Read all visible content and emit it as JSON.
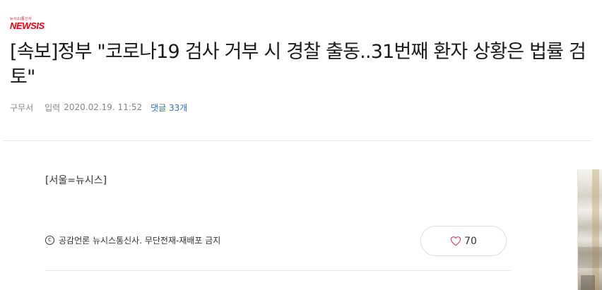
{
  "logo": {
    "tagline": "뉴시스|통신사",
    "wordmark": "NEWSIS",
    "color": "#e60012"
  },
  "article": {
    "headline": "[속보]정부 \"코로나19 검사 거부 시 경찰 출동..31번째 환자 상황은 법률 검토\"",
    "reporter": "구무서",
    "date_label": "입력",
    "date_value": "2020.02.19. 11:52",
    "comments_label": "댓글 33개",
    "dateline": "[서울=뉴시스]",
    "copyright_mark": "c",
    "copyright_text": "공감언론 뉴시스통신사. 무단전재-재배포 금지"
  },
  "like": {
    "icon": "heart-icon",
    "count": "70"
  },
  "colors": {
    "link": "#2f6fc5",
    "heart": "#d9435e",
    "divider": "#e4e4e4"
  }
}
